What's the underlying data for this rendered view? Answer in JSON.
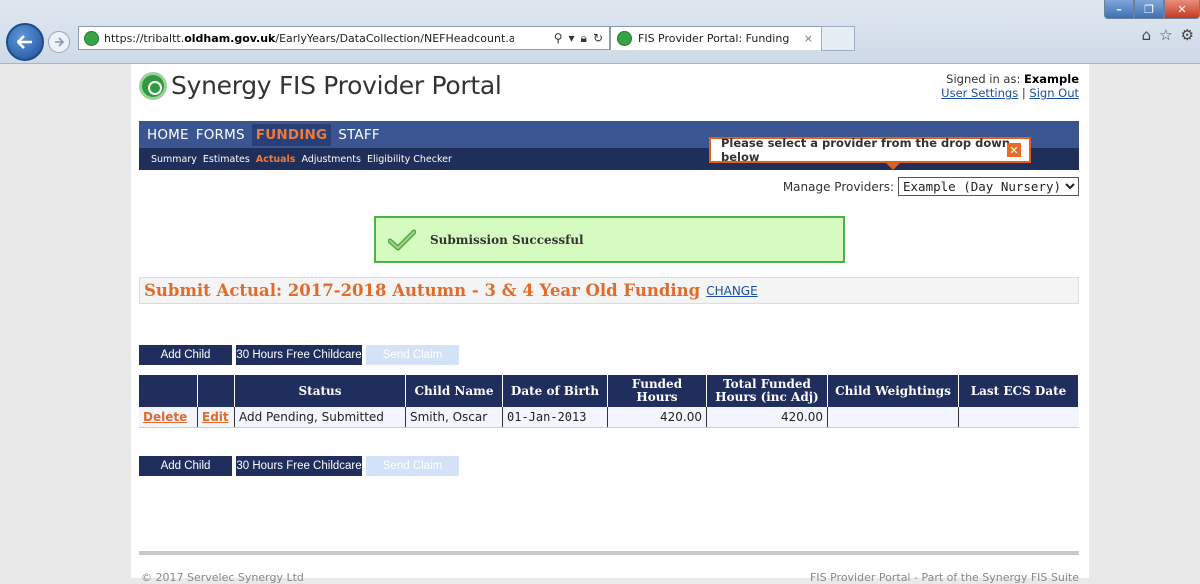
{
  "browser": {
    "url_prefix": "https://tribaltt.",
    "url_domain": "oldham.gov.uk",
    "url_path": "/EarlyYears/DataCollection/NEFHeadcount.aspx?Tab=Act",
    "tab_title": "FIS Provider Portal: Funding",
    "tab_close": "×",
    "window": {
      "minimize": "–",
      "maximize": "❐",
      "close": "✕"
    },
    "tools": {
      "home": "⌂",
      "favorites": "☆",
      "settings": "⚙"
    }
  },
  "header": {
    "logo_text": "Synergy FIS Provider Portal",
    "signed_in_prefix": "Signed in as: ",
    "signed_in_user": "Example",
    "user_settings": "User Settings",
    "separator": " | ",
    "sign_out": "Sign Out"
  },
  "nav": {
    "main": [
      "HOME",
      "FORMS",
      "FUNDING",
      "STAFF"
    ],
    "sub": [
      "Summary",
      "Estimates",
      "Actuals",
      "Adjustments",
      "Eligibility Checker"
    ]
  },
  "tooltip": {
    "text": "Please select a provider from the drop down below",
    "close": "✕"
  },
  "manage": {
    "label": "Manage Providers:",
    "selected": "Example (Day Nursery)"
  },
  "success": {
    "message": "Submission Successful"
  },
  "submit": {
    "title": "Submit Actual: 2017-2018 Autumn - 3 & 4 Year Old Funding",
    "change": "CHANGE"
  },
  "buttons": {
    "add_child": "Add Child",
    "free_childcare": "30 Hours Free Childcare",
    "send_claim": "Send Claim"
  },
  "table": {
    "headers": [
      "",
      "",
      "Status",
      "Child Name",
      "Date of Birth",
      "Funded Hours",
      "Total Funded Hours (inc Adj)",
      "Child Weightings",
      "Last ECS Date"
    ],
    "rows": [
      {
        "delete": "Delete",
        "edit": "Edit",
        "status": "Add Pending, Submitted",
        "name": "Smith, Oscar",
        "dob": "01-Jan-2013",
        "funded": "420.00",
        "total": "420.00",
        "weightings": "",
        "last_ecs": ""
      }
    ]
  },
  "footer": {
    "left": "© 2017 Servelec Synergy Ltd",
    "right": "FIS Provider Portal - Part of the Synergy FIS Suite"
  },
  "colors": {
    "nav_bg": "#3b5591",
    "accent": "#e06b2c",
    "success_bg": "#d6fbc1"
  }
}
